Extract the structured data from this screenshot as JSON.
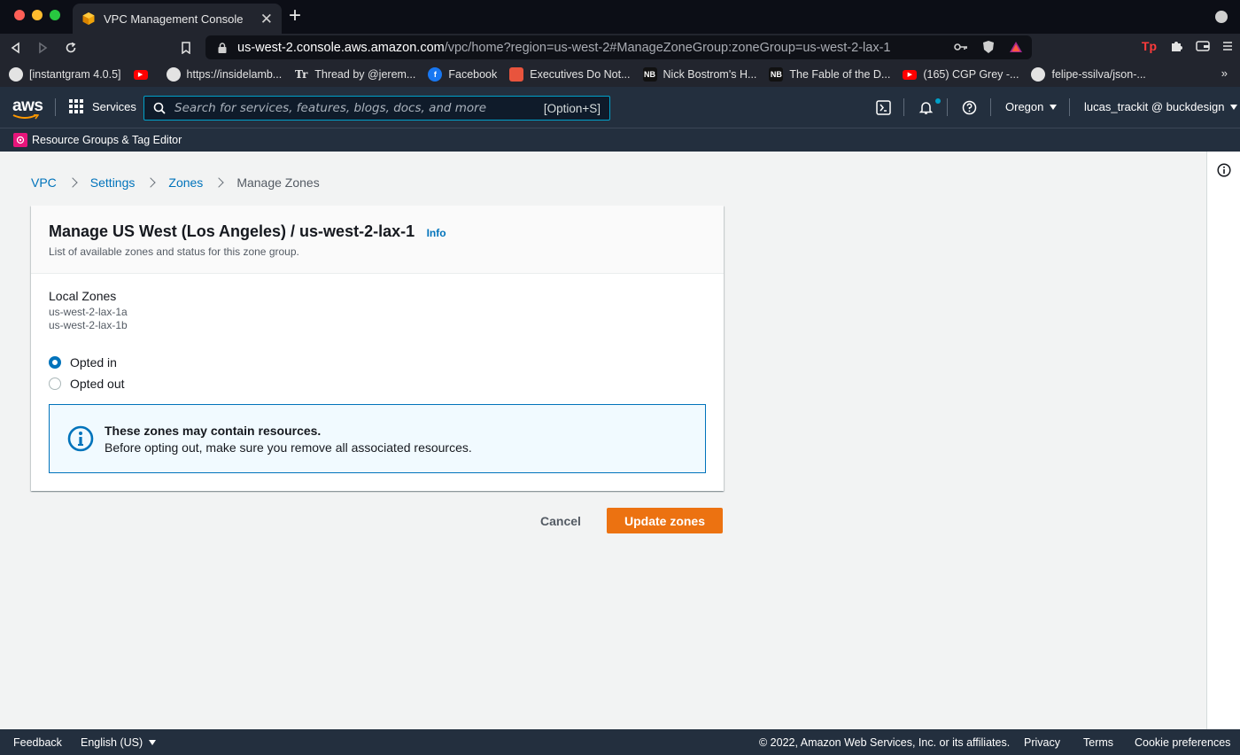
{
  "browser": {
    "tab_title": "VPC Management Console",
    "url_host": "us-west-2.console.aws.amazon.com",
    "url_path": "/vpc/home?region=us-west-2#ManageZoneGroup:zoneGroup=us-west-2-lax-1",
    "bookmarks": [
      {
        "label": "[instantgram 4.0.5]",
        "icon": "globe-icon"
      },
      {
        "label": "",
        "icon": "youtube-icon"
      },
      {
        "label": "https://insidelamb...",
        "icon": "globe-icon"
      },
      {
        "label": "Thread by @jerem...",
        "icon": "tr-icon"
      },
      {
        "label": "Facebook",
        "icon": "facebook-icon"
      },
      {
        "label": "Executives Do Not...",
        "icon": "stripes-icon"
      },
      {
        "label": "Nick Bostrom's H...",
        "icon": "nb-icon"
      },
      {
        "label": "The Fable of the D...",
        "icon": "nb-icon"
      },
      {
        "label": "(165) CGP Grey -...",
        "icon": "youtube-icon"
      },
      {
        "label": "felipe-ssilva/json-...",
        "icon": "github-icon"
      }
    ],
    "bookmarks_more": "»"
  },
  "aws_header": {
    "logo": "aws",
    "services_label": "Services",
    "search_placeholder": "Search for services, features, blogs, docs, and more",
    "search_shortcut": "[Option+S]",
    "region": "Oregon",
    "user": "lucas_trackit @ buckdesign",
    "subnav_label": "Resource Groups & Tag Editor"
  },
  "breadcrumb": {
    "items": [
      "VPC",
      "Settings",
      "Zones"
    ],
    "current": "Manage Zones"
  },
  "panel": {
    "title": "Manage US West (Los Angeles) / us-west-2-lax-1",
    "info_label": "Info",
    "description": "List of available zones and status for this zone group.",
    "local_zones_label": "Local Zones",
    "zones": [
      "us-west-2-lax-1a",
      "us-west-2-lax-1b"
    ],
    "options": [
      {
        "label": "Opted in",
        "selected": true
      },
      {
        "label": "Opted out",
        "selected": false
      }
    ],
    "alert_title": "These zones may contain resources.",
    "alert_text": "Before opting out, make sure you remove all associated resources."
  },
  "actions": {
    "cancel": "Cancel",
    "update": "Update zones"
  },
  "footer": {
    "feedback": "Feedback",
    "language": "English (US)",
    "copyright": "© 2022, Amazon Web Services, Inc. or its affiliates.",
    "privacy": "Privacy",
    "terms": "Terms",
    "cookies": "Cookie preferences"
  },
  "colors": {
    "aws_nav": "#232f3e",
    "primary_button": "#ec7211",
    "link": "#0073bb"
  }
}
